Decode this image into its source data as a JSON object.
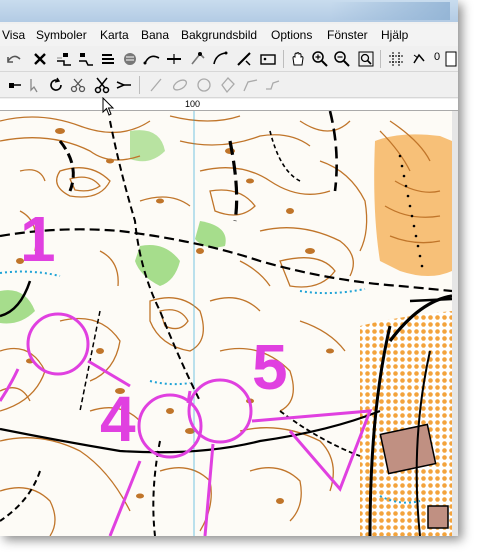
{
  "menu": {
    "items": [
      "Visa",
      "Symboler",
      "Karta",
      "Bana",
      "Bakgrundsbild",
      "Options",
      "Fönster",
      "Hjälp"
    ]
  },
  "toolbar1": {
    "field_value": "0"
  },
  "ruler": {
    "label": "100"
  },
  "course": {
    "controls": [
      {
        "number": "1"
      },
      {
        "number": "4"
      },
      {
        "number": "5"
      }
    ],
    "overprint_color": "#e040e0"
  },
  "colors": {
    "contour": "#c0752a",
    "vegetation_green": "#a6dd8c",
    "open_land": "#f7c078",
    "water": "#1fa3d6",
    "path": "#000000"
  }
}
